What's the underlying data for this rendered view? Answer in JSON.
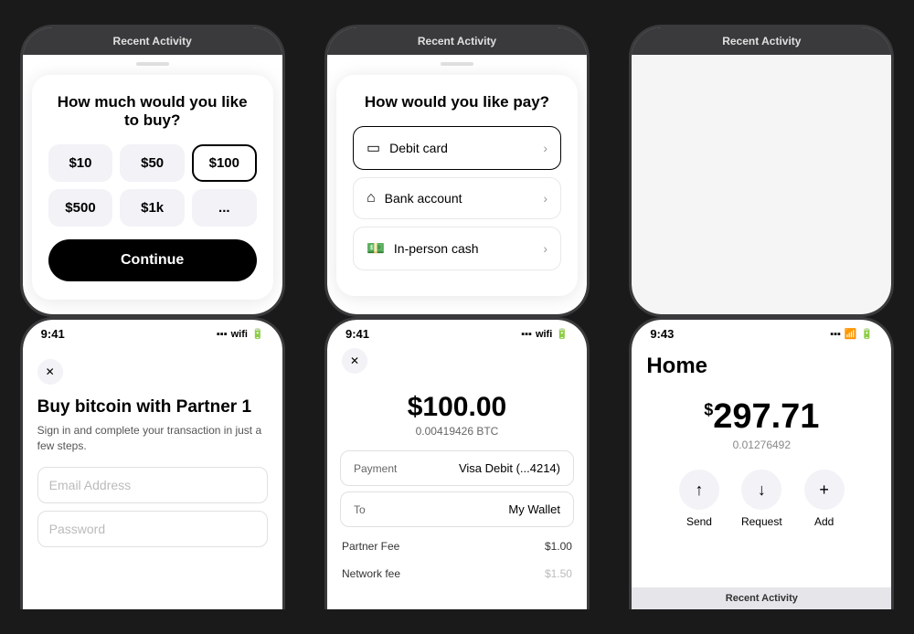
{
  "phones": {
    "phone1": {
      "recent_activity": "Recent Activity",
      "sheet_title": "How much would you like to buy?",
      "amounts": [
        "$10",
        "$50",
        "$100",
        "$500",
        "$1k",
        "..."
      ],
      "selected_index": 2,
      "continue_label": "Continue"
    },
    "phone2": {
      "recent_activity": "Recent Activity",
      "sheet_title": "How would you like pay?",
      "options": [
        {
          "icon": "💳",
          "label": "Debit card",
          "selected": true
        },
        {
          "icon": "🏠",
          "label": "Bank account",
          "selected": false
        },
        {
          "icon": "💵",
          "label": "In-person cash",
          "selected": false
        }
      ]
    },
    "phone3": {
      "recent_activity": "Recent Activity"
    },
    "phone4": {
      "time": "9:41",
      "buy_title": "Buy bitcoin with Partner 1",
      "buy_subtitle": "Sign in and complete your transaction in just a few steps.",
      "email_placeholder": "Email Address",
      "password_placeholder": "Password"
    },
    "phone5": {
      "time": "9:41",
      "amount": "$100.00",
      "crypto_amount": "0.00419426 BTC",
      "payment_label": "Payment",
      "payment_value": "Visa Debit (...4214)",
      "to_label": "To",
      "to_value": "My Wallet",
      "partner_fee_label": "Partner Fee",
      "partner_fee_value": "$1.00",
      "network_fee_label": "Network fee"
    },
    "phone6": {
      "time": "9:43",
      "home_title": "Home",
      "balance_symbol": "$",
      "balance_amount": "297.71",
      "balance_crypto": "0.01276492",
      "send_label": "Send",
      "request_label": "Request",
      "add_label": "Add",
      "recent_activity": "Recent Activity"
    }
  }
}
